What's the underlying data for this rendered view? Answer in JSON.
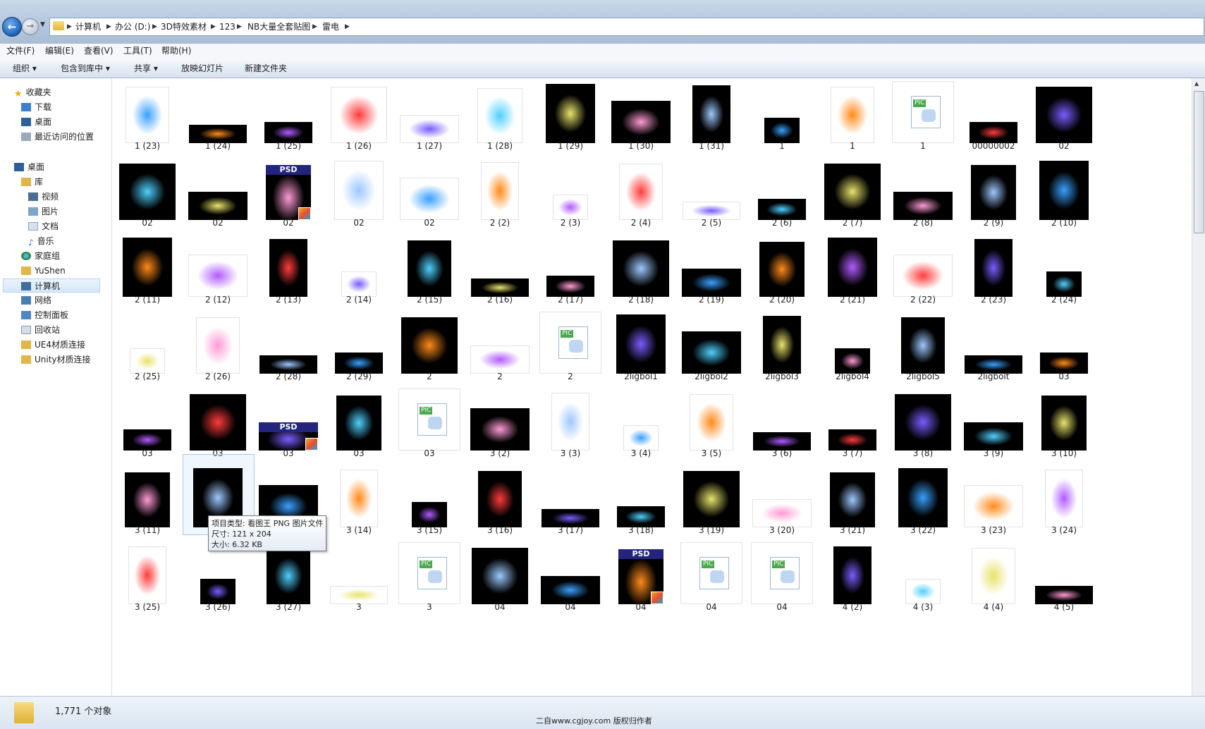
{
  "address": {
    "crumbs": [
      "计算机",
      "办公 (D:)",
      "3D特效素材",
      "123",
      "NB大量全套贴图",
      "雷电"
    ]
  },
  "menu": [
    "文件(F)",
    "编辑(E)",
    "查看(V)",
    "工具(T)",
    "帮助(H)"
  ],
  "toolbar": {
    "organize": "组织 ▾",
    "include": "包含到库中 ▾",
    "share": "共享 ▾",
    "slideshow": "放映幻灯片",
    "new_folder": "新建文件夹"
  },
  "sidebar": {
    "favorites": {
      "title": "收藏夹",
      "items": [
        "下载",
        "桌面",
        "最近访问的位置"
      ]
    },
    "desktop": {
      "title": "桌面",
      "items": [
        "库",
        "视频",
        "图片",
        "文档",
        "音乐",
        "家庭组",
        "YuShen",
        "计算机",
        "网络",
        "控制面板",
        "回收站",
        "UE4材质连接",
        "Unity材质连接"
      ]
    }
  },
  "files": [
    [
      "1 (23)",
      "1 (24)",
      "1 (25)",
      "1 (26)",
      "1 (27)",
      "1 (28)",
      "1 (29)",
      "1 (30)",
      "1 (31)",
      "1",
      "1",
      "1",
      "00000002",
      "02"
    ],
    [
      "02",
      "02",
      "02",
      "02",
      "02",
      "2 (2)",
      "2 (3)",
      "2 (4)",
      "2 (5)",
      "2 (6)",
      "2 (7)",
      "2 (8)",
      "2 (9)",
      "2 (10)"
    ],
    [
      "2 (11)",
      "2 (12)",
      "2 (13)",
      "2 (14)",
      "2 (15)",
      "2 (16)",
      "2 (17)",
      "2 (18)",
      "2 (19)",
      "2 (20)",
      "2 (21)",
      "2 (22)",
      "2 (23)",
      "2 (24)"
    ],
    [
      "2 (25)",
      "2 (26)",
      "2 (28)",
      "2 (29)",
      "2",
      "2",
      "2",
      "2ligbol1",
      "2ligbol2",
      "2ligbol3",
      "2ligbol4",
      "2ligbol5",
      "2ligbolt",
      "03"
    ],
    [
      "03",
      "03",
      "03",
      "03",
      "03",
      "3 (2)",
      "3 (3)",
      "3 (4)",
      "3 (5)",
      "3 (6)",
      "3 (7)",
      "3 (8)",
      "3 (9)",
      "3 (10)"
    ],
    [
      "3 (11)",
      "",
      "",
      "3 (14)",
      "3 (15)",
      "3 (16)",
      "3 (17)",
      "3 (18)",
      "3 (19)",
      "3 (20)",
      "3 (21)",
      "3 (22)",
      "3 (23)",
      "3 (24)"
    ],
    [
      "3 (25)",
      "3 (26)",
      "3 (27)",
      "3",
      "3",
      "04",
      "04",
      "04",
      "04",
      "04",
      "4 (2)",
      "4 (3)",
      "4 (4)",
      "4 (5)"
    ]
  ],
  "tooltip": {
    "type": "项目类型: 看图王 PNG 图片文件",
    "size": "尺寸: 121 x 204",
    "filesize": "大小: 6.32 KB"
  },
  "psd_label": "PSD",
  "pic_label": "PIC",
  "status": {
    "count": "1,771 个对象",
    "watermark": "二自www.cgjoy.com 版权归作者"
  }
}
